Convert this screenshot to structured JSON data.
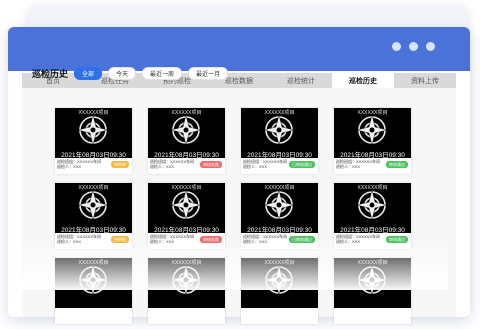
{
  "nav": {
    "tabs": [
      {
        "label": "首页"
      },
      {
        "label": "巡检任务"
      },
      {
        "label": "预约巡检"
      },
      {
        "label": "巡检数据"
      },
      {
        "label": "巡检统计"
      },
      {
        "label": "巡检历史",
        "active": true
      },
      {
        "label": "资料上传"
      }
    ]
  },
  "page": {
    "title": "巡检历史",
    "filters": [
      {
        "label": "全部",
        "active": true
      },
      {
        "label": "今天"
      },
      {
        "label": "最近一周"
      },
      {
        "label": "最近一月"
      }
    ]
  },
  "colors": {
    "titlebar": "#4a72d9",
    "accent": "#2f6fe8",
    "badge_pending": "#f5b940",
    "badge_failed": "#ee6b6b",
    "badge_passed": "#4cc25e"
  },
  "cards": [
    {
      "project": "XXXXXX项目",
      "date": "2021年08月03日09:30",
      "info1": "巡检班组：XXXXXX车间",
      "info2": "巡检人：XXX",
      "status": "待审核",
      "status_color": "#f5b940"
    },
    {
      "project": "XXXXXX项目",
      "date": "2021年08月03日09:30",
      "info1": "巡检班组：XXXXXX车间",
      "info2": "巡检人：XXX",
      "status": "审核失败",
      "status_color": "#ee6b6b"
    },
    {
      "project": "XXXXXX项目",
      "date": "2021年08月03日09:30",
      "info1": "巡检班组：XXXXXX车间",
      "info2": "巡检人：XXX",
      "status": "已审核通过",
      "status_color": "#4cc25e"
    },
    {
      "project": "XXXXXX项目",
      "date": "2021年08月03日09:30",
      "info1": "巡检班组：XXXXXX车间",
      "info2": "巡检人：XXX",
      "status": "审核通过",
      "status_color": "#4cc25e"
    },
    {
      "project": "XXXXXX项目",
      "date": "2021年08月03日09:30",
      "info1": "巡检班组：XXXXXX车间",
      "info2": "巡检人：XXX",
      "status": "待审核",
      "status_color": "#f5b940"
    },
    {
      "project": "XXXXXX项目",
      "date": "2021年08月03日09:30",
      "info1": "巡检班组：XXXXXX车间",
      "info2": "巡检人：XXX",
      "status": "审核失败",
      "status_color": "#ee6b6b"
    },
    {
      "project": "XXXXXX项目",
      "date": "2021年08月03日09:30",
      "info1": "巡检班组：XXXXXX车间",
      "info2": "巡检人：XXX",
      "status": "已审核通过",
      "status_color": "#4cc25e"
    },
    {
      "project": "XXXXXX项目",
      "date": "2021年08月03日09:30",
      "info1": "巡检班组：XXXXXX车间",
      "info2": "巡检人：XXX",
      "status": "审核通过",
      "status_color": "#4cc25e"
    },
    {
      "project": "XXXXXX项目",
      "date": "",
      "info1": "",
      "info2": "",
      "status": "",
      "status_color": "#cccccc"
    },
    {
      "project": "XXXXXX项目",
      "date": "",
      "info1": "",
      "info2": "",
      "status": "",
      "status_color": "#cccccc"
    },
    {
      "project": "XXXXXX项目",
      "date": "",
      "info1": "",
      "info2": "",
      "status": "",
      "status_color": "#cccccc"
    },
    {
      "project": "XXXXXX项目",
      "date": "",
      "info1": "",
      "info2": "",
      "status": "",
      "status_color": "#cccccc"
    }
  ]
}
